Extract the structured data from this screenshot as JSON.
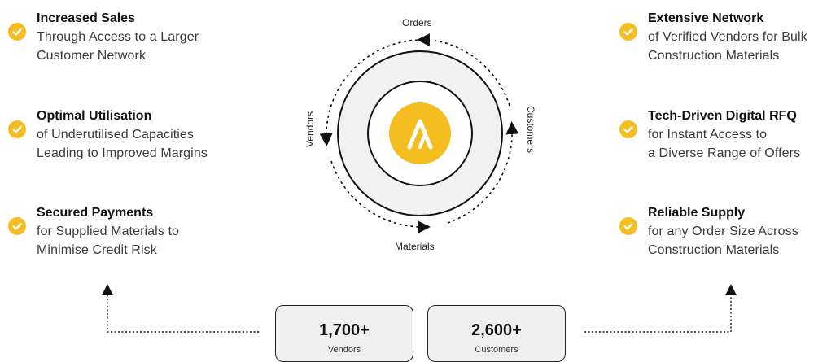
{
  "benefits_left": [
    {
      "title": "Increased Sales",
      "lines": [
        "Through Access to a Larger",
        "Customer Network"
      ]
    },
    {
      "title": "Optimal Utilisation",
      "lines": [
        "of Underutilised Capacities",
        "Leading to Improved Margins"
      ]
    },
    {
      "title": "Secured Payments",
      "lines": [
        "for Supplied Materials to",
        "Minimise Credit Risk"
      ]
    }
  ],
  "benefits_right": [
    {
      "title": "Extensive Network",
      "lines": [
        "of Verified Vendors for Bulk",
        "Construction Materials"
      ]
    },
    {
      "title": "Tech-Driven Digital RFQ",
      "lines": [
        "for Instant Access to",
        "a Diverse Range of Offers"
      ]
    },
    {
      "title": "Reliable Supply",
      "lines": [
        "for any Order Size Across",
        "Construction Materials"
      ]
    }
  ],
  "cycle": {
    "top_label": "Orders",
    "right_label": "Customers",
    "bottom_label": "Materials",
    "left_label": "Vendors"
  },
  "stats": [
    {
      "value": "1,700+",
      "label": "Vendors"
    },
    {
      "value": "2,600+",
      "label": "Customers"
    }
  ],
  "colors": {
    "accent": "#f5bd1f",
    "ring_fill": "#f2f2f2",
    "text": "#1a1a1a"
  },
  "icons": {
    "benefit": "check-circle-icon",
    "center": "brand-logo-icon"
  }
}
